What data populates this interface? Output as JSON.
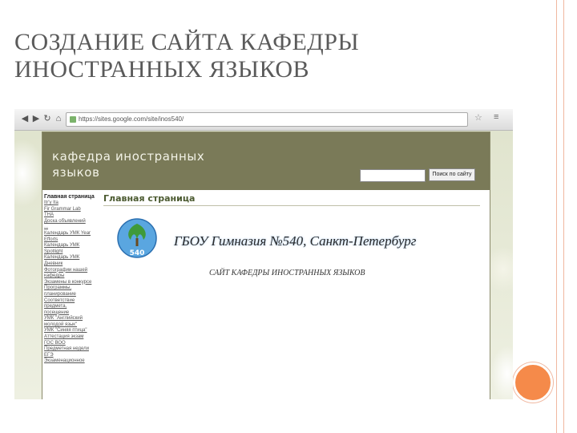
{
  "slide": {
    "title_line1": "СОЗДАНИЕ САЙТА КАФЕДРЫ",
    "title_line2": "ИНОСТРАННЫХ ЯЗЫКОВ"
  },
  "browser": {
    "url": "https://sites.google.com/site/inos540/"
  },
  "site": {
    "title": "кафедра иностранных языков",
    "search_button": "Поиск по сайту",
    "search_value": "",
    "sidebar_items": [
      "Главная страница",
      "Itr'y Ita",
      "Fir Grammar Lab",
      "THA",
      "Доска объявлений",
      "...",
      "Календарь УМК Year",
      "Efforts",
      "Календарь УМК",
      "Spotlight",
      "Календарь УМК",
      "Дневник",
      "Фотографии нашей",
      "кафедры",
      "Экзамены в конкурсе",
      "Программы,",
      "планирование",
      "Соответствие предмета,",
      "посещение",
      "УМК \"Английский",
      "молодой язык\"",
      "УМК \"Синяя птица\"",
      "Аттестация экзам",
      "ГОС ВОО",
      "Предметная недели",
      "ЕГЭ",
      "Экзаменационное"
    ],
    "page_heading": "Главная страница",
    "school_name": "ГБОУ Гимназия №540, Санкт-Петербург",
    "dept_caption": "САЙТ КАФЕДРЫ ИНОСТРАННЫХ ЯЗЫКОВ",
    "logo_number": "540"
  }
}
